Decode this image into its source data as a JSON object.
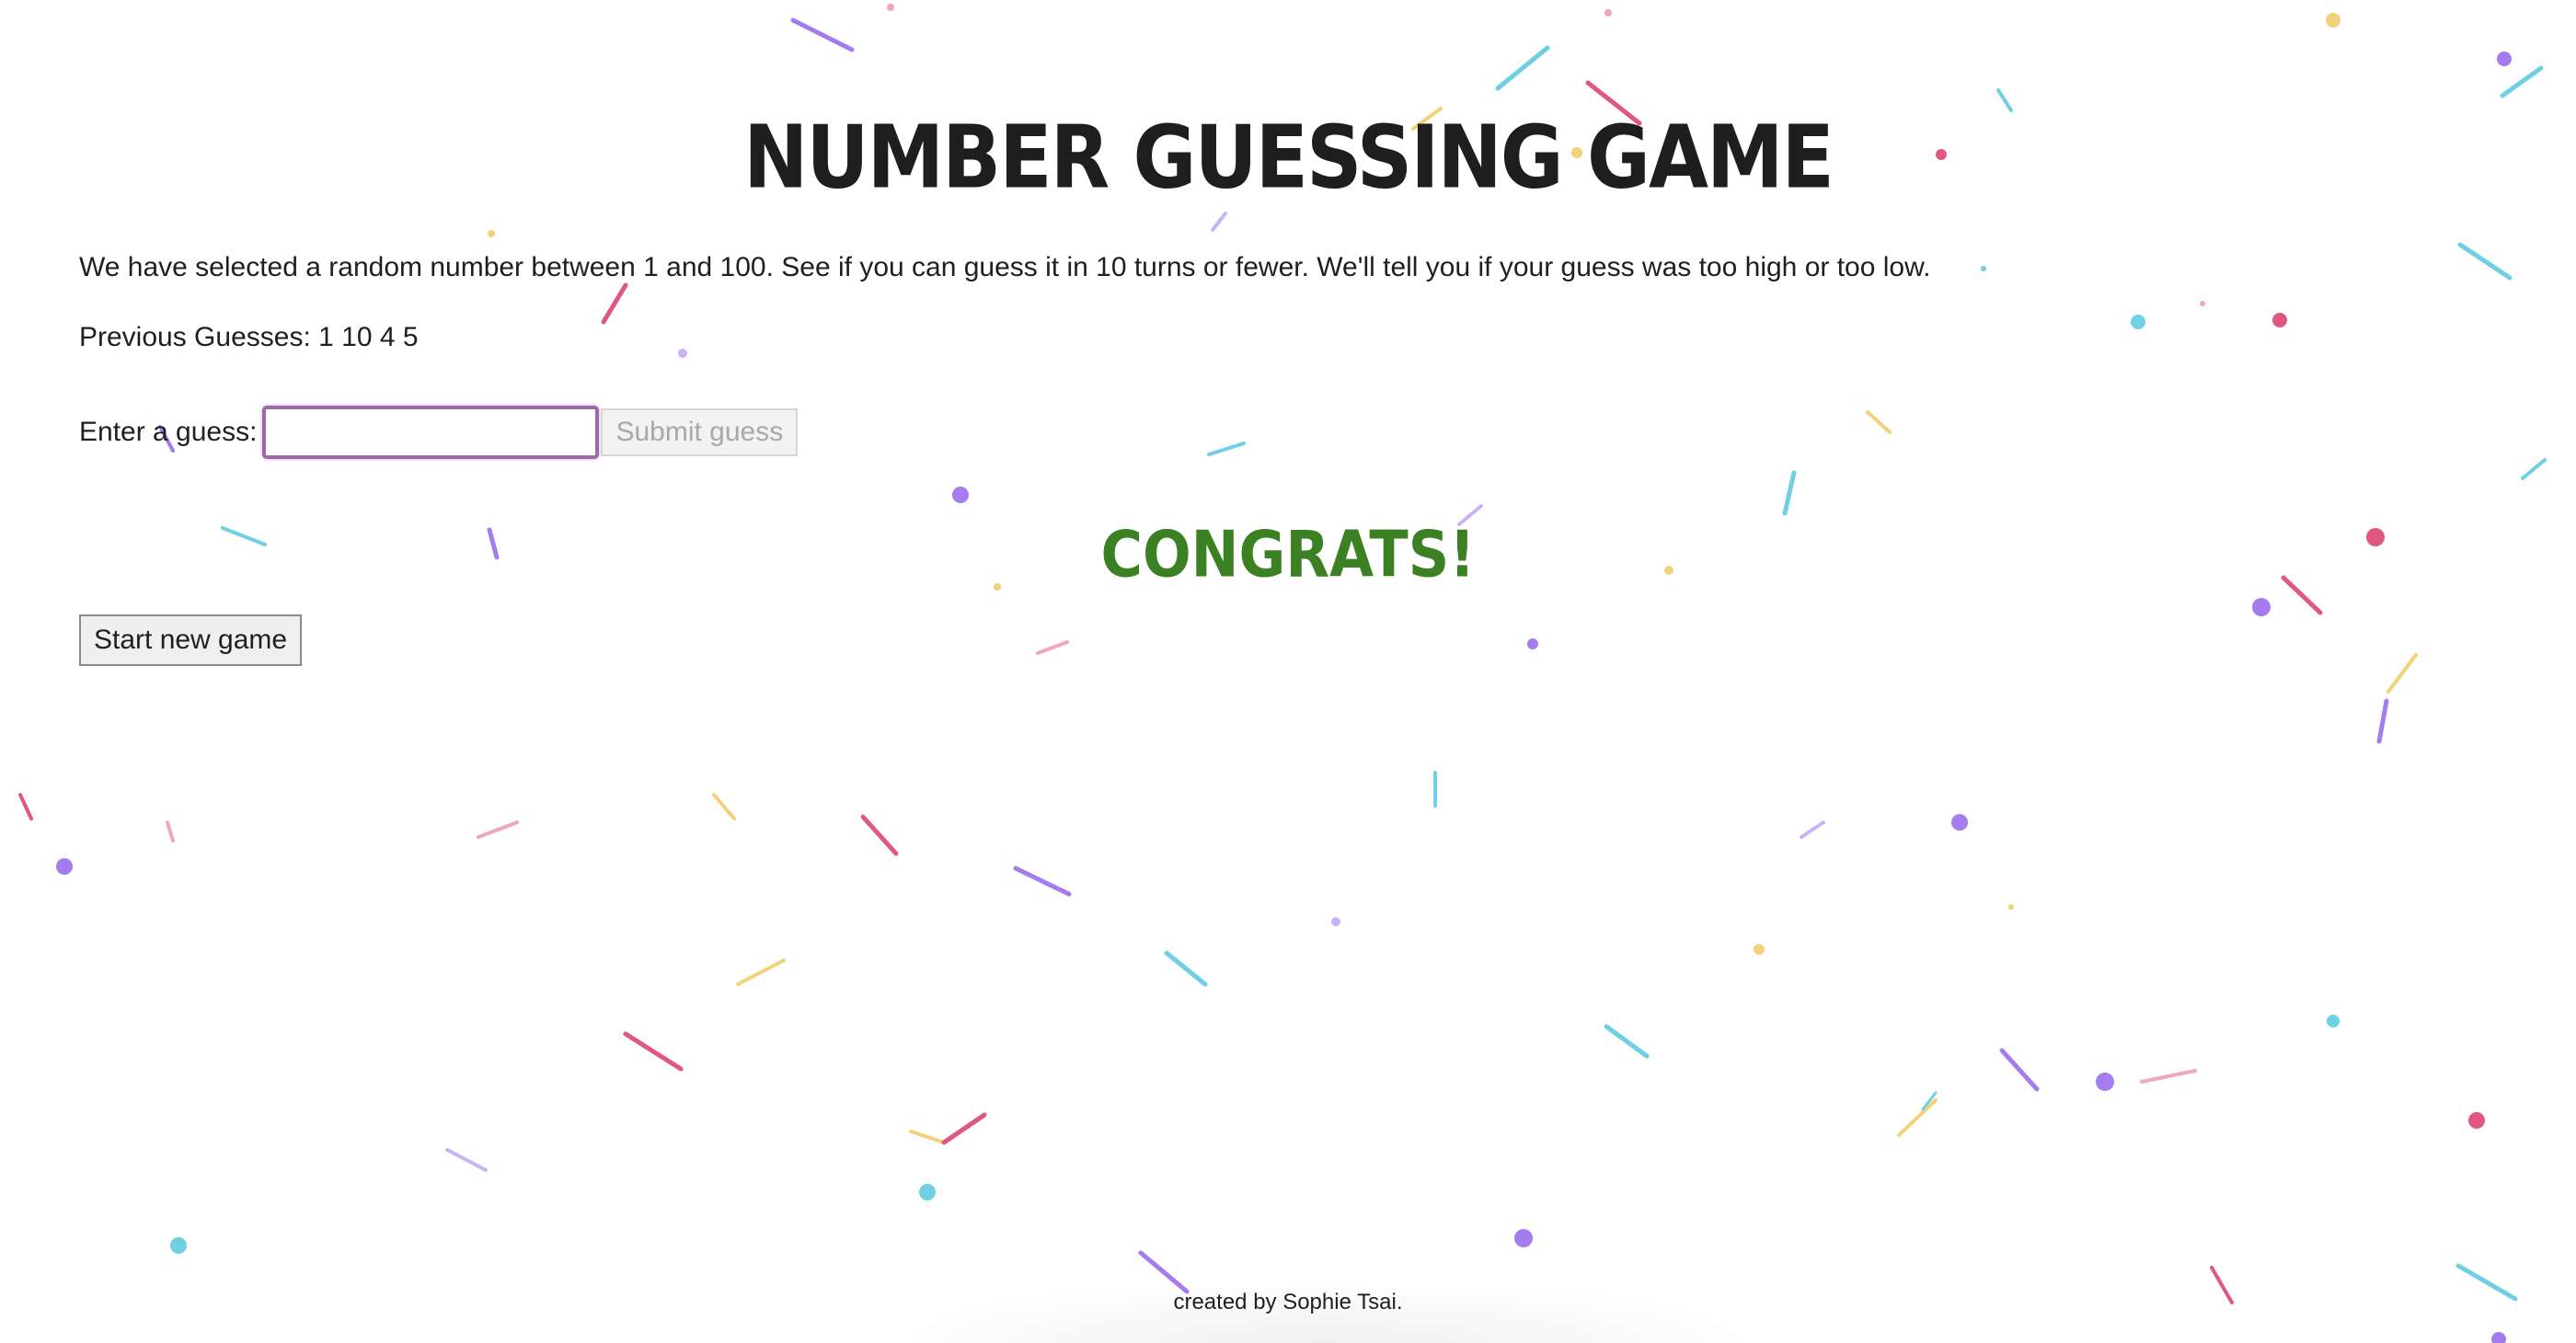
{
  "title": "NUMBER GUESSING GAME",
  "intro": "We have selected a random number between 1 and 100. See if you can guess it in 10 turns or fewer. We'll tell you if your guess was too high or too low.",
  "previous_guesses": "Previous Guesses: 1 10 4 5",
  "guess_form": {
    "label": "Enter a guess:",
    "input_value": "",
    "input_placeholder": "",
    "submit_label": "Submit guess"
  },
  "result": "CONGRATS!",
  "new_game_label": "Start new game",
  "footer": "created by Sophie Tsai.",
  "colors": {
    "accent_green": "#3c8024",
    "input_border": "#9c6aa8",
    "confetti": [
      "#a57cf0",
      "#6fcfe3",
      "#e0577f",
      "#f5d07a",
      "#f0a5c0",
      "#c9b2f5"
    ]
  }
}
